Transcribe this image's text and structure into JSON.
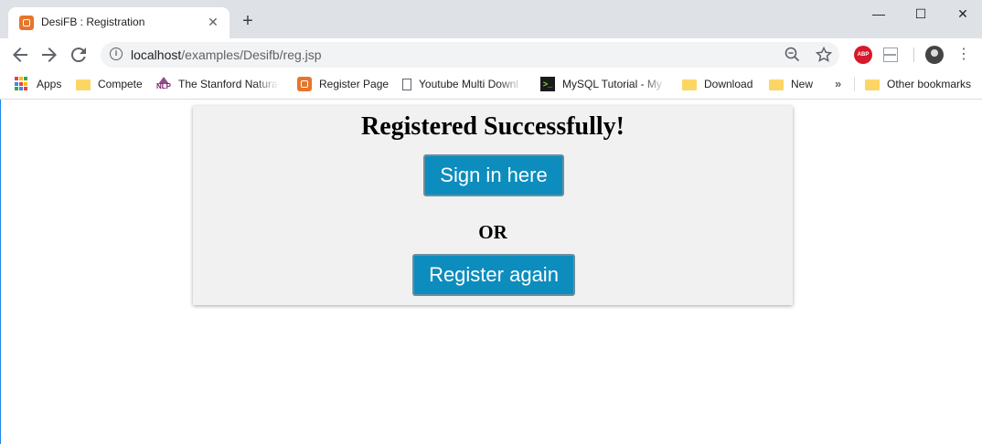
{
  "browser": {
    "tab_title": "DesiFB : Registration",
    "tab_close_glyph": "✕",
    "new_tab_glyph": "+",
    "url_host": "localhost",
    "url_path": "/examples/Desifb/reg.jsp",
    "abp_label": "ABP",
    "window_controls": {
      "minimize": "—",
      "maximize": "☐",
      "close": "✕"
    }
  },
  "bookmarks": [
    {
      "label": "Apps",
      "icon": "apps-grid-icon"
    },
    {
      "label": "Compete",
      "icon": "folder-icon"
    },
    {
      "label": "The Stanford Natural",
      "icon": "nlp-icon"
    },
    {
      "label": "Register Page",
      "icon": "xampp-icon"
    },
    {
      "label": "Youtube Multi Downl",
      "icon": "document-icon"
    },
    {
      "label": "MySQL Tutorial - My",
      "icon": "terminal-icon"
    },
    {
      "label": "Download",
      "icon": "folder-icon"
    },
    {
      "label": "New",
      "icon": "folder-icon"
    },
    {
      "label": "Other bookmarks",
      "icon": "folder-icon"
    }
  ],
  "bookmarks_overflow": "»",
  "page": {
    "heading": "Registered Successfully!",
    "signin_label": "Sign in here",
    "or_text": "OR",
    "register_label": "Register again"
  },
  "colors": {
    "button_bg": "#0c8dbd",
    "card_bg": "#f1f1f1",
    "tab_strip": "#dee1e6"
  }
}
